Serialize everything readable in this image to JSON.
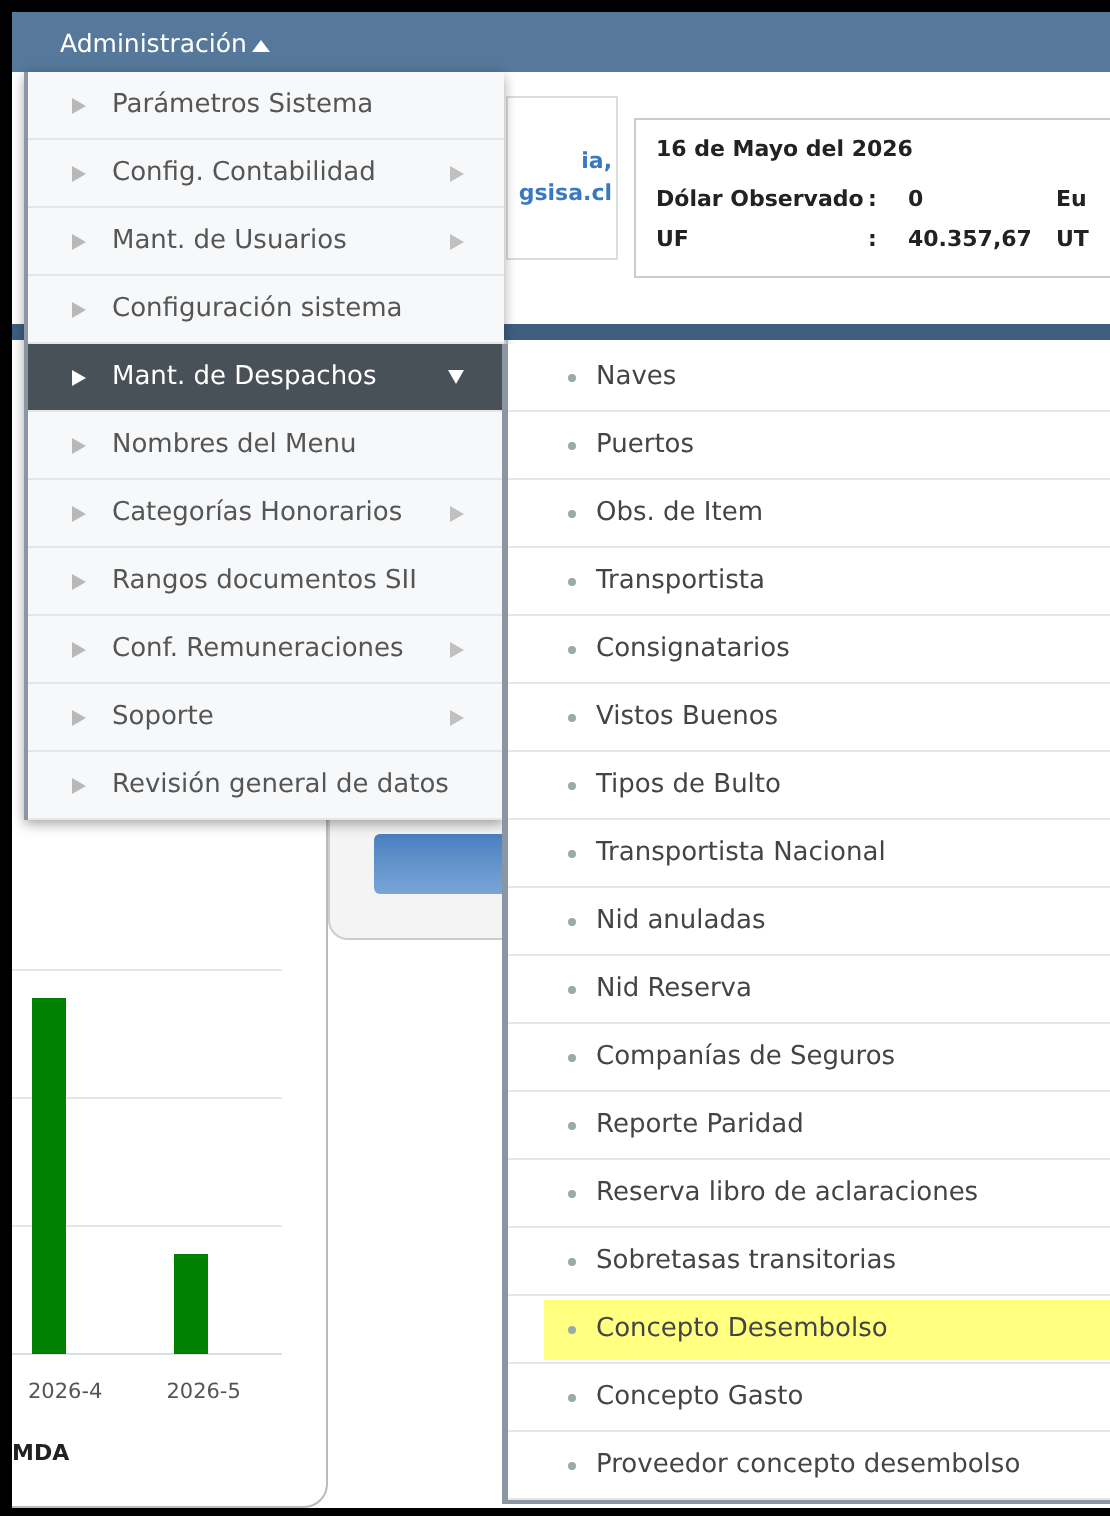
{
  "menu_bar": {
    "label": "Administración",
    "expanded": true
  },
  "header": {
    "link_lines": [
      "ia,",
      "gsisa.cl"
    ],
    "info": {
      "date": "16 de Mayo del 2026",
      "rows": [
        {
          "label": "Dólar Observado",
          "sep": ":",
          "value": "0",
          "next": "Eu"
        },
        {
          "label": "UF",
          "sep": ":",
          "value": "40.357,67",
          "next": "UT"
        }
      ]
    }
  },
  "chart_panel": {
    "categories": [
      "2026-4",
      "2026-5"
    ],
    "footer": "MDA"
  },
  "menu": [
    {
      "label": "Parámetros Sistema",
      "has_submenu": false,
      "selected": false
    },
    {
      "label": "Config. Contabilidad",
      "has_submenu": true,
      "selected": false
    },
    {
      "label": "Mant. de Usuarios",
      "has_submenu": true,
      "selected": false
    },
    {
      "label": "Configuración sistema",
      "has_submenu": false,
      "selected": false
    },
    {
      "label": "Mant. de Despachos",
      "has_submenu": true,
      "selected": true
    },
    {
      "label": "Nombres del Menu",
      "has_submenu": false,
      "selected": false
    },
    {
      "label": "Categorías Honorarios",
      "has_submenu": true,
      "selected": false
    },
    {
      "label": "Rangos documentos SII",
      "has_submenu": false,
      "selected": false
    },
    {
      "label": "Conf. Remuneraciones",
      "has_submenu": true,
      "selected": false
    },
    {
      "label": "Soporte",
      "has_submenu": true,
      "selected": false
    },
    {
      "label": "Revisión general de datos",
      "has_submenu": false,
      "selected": false
    }
  ],
  "submenu": [
    {
      "label": "Naves",
      "highlighted": false
    },
    {
      "label": "Puertos",
      "highlighted": false
    },
    {
      "label": "Obs. de Item",
      "highlighted": false
    },
    {
      "label": "Transportista",
      "highlighted": false
    },
    {
      "label": "Consignatarios",
      "highlighted": false
    },
    {
      "label": "Vistos Buenos",
      "highlighted": false
    },
    {
      "label": "Tipos de Bulto",
      "highlighted": false
    },
    {
      "label": "Transportista Nacional",
      "highlighted": false
    },
    {
      "label": "Nid anuladas",
      "highlighted": false
    },
    {
      "label": "Nid Reserva",
      "highlighted": false
    },
    {
      "label": "Companías de Seguros",
      "highlighted": false
    },
    {
      "label": "Reporte Paridad",
      "highlighted": false
    },
    {
      "label": "Reserva libro de aclaraciones",
      "highlighted": false
    },
    {
      "label": "Sobretasas transitorias",
      "highlighted": false
    },
    {
      "label": "Concepto Desembolso",
      "highlighted": true
    },
    {
      "label": "Concepto Gasto",
      "highlighted": false
    },
    {
      "label": "Proveedor concepto desembolso",
      "highlighted": false
    }
  ]
}
